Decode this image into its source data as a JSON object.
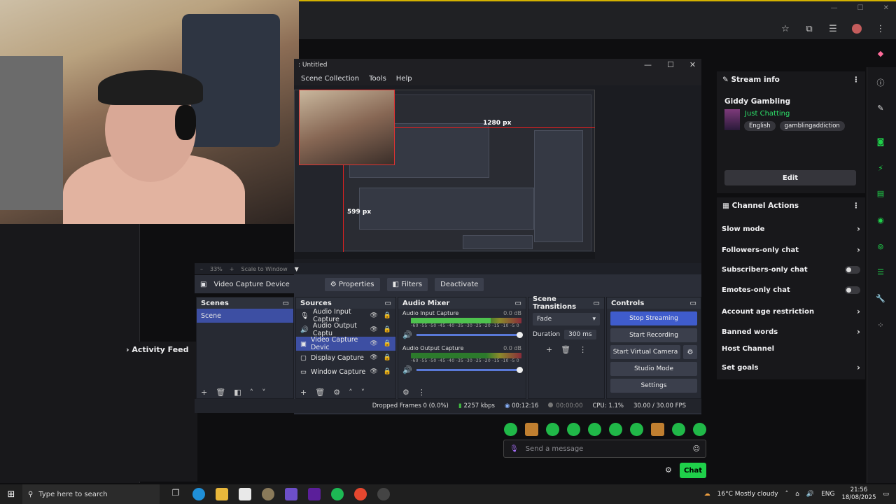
{
  "obs": {
    "title": ": Untitled",
    "menu": [
      "Scene Collection",
      "Tools",
      "Help"
    ],
    "preview_width_label": "1280 px",
    "preview_height_label": "599 px",
    "zoom": {
      "percent": "33%",
      "scale_label": "Scale to Window"
    },
    "source_toolbar": {
      "source_name": "Video Capture Device",
      "properties": "Properties",
      "filters": "Filters",
      "deactivate": "Deactivate"
    },
    "scenes": {
      "title": "Scenes",
      "items": [
        "Scene"
      ]
    },
    "sources": {
      "title": "Sources",
      "items": [
        "Audio Input Capture",
        "Audio Output Captu",
        "Video Capture Devic",
        "Display Capture",
        "Window Capture"
      ]
    },
    "audio_mixer": {
      "title": "Audio Mixer",
      "tracks": [
        {
          "name": "Audio Input Capture",
          "db": "0.0 dB",
          "level": 0.72,
          "volume": 1.0
        },
        {
          "name": "Audio Output Capture",
          "db": "0.0 dB",
          "level": 0.0,
          "volume": 1.0
        }
      ],
      "scale": "-60 -55 -50 -45 -40 -35 -30 -25 -20 -15 -10 -5 0"
    },
    "transitions": {
      "title": "Scene Transitions",
      "selected": "Fade",
      "duration_label": "Duration",
      "duration_value": "300 ms"
    },
    "controls": {
      "title": "Controls",
      "stop_streaming": "Stop Streaming",
      "start_recording": "Start Recording",
      "start_virtual_camera": "Start Virtual Camera",
      "studio_mode": "Studio Mode",
      "settings": "Settings"
    },
    "status": {
      "dropped_frames": "Dropped Frames 0 (0.0%)",
      "bitrate": "2257 kbps",
      "stream_time": "00:12:16",
      "record_time": "00:00:00",
      "cpu": "CPU: 1.1%",
      "fps": "30.00 / 30.00 FPS"
    }
  },
  "activity_feed": {
    "title": "Activity Feed"
  },
  "stream_info": {
    "title": "Stream info",
    "channel_name": "Giddy Gambling",
    "category": "Just Chatting",
    "tags": [
      "English",
      "gamblingaddiction"
    ],
    "edit_label": "Edit"
  },
  "channel_actions": {
    "title": "Channel Actions",
    "items": [
      {
        "label": "Slow mode",
        "control": "chevron"
      },
      {
        "label": "Followers-only chat",
        "control": "chevron"
      },
      {
        "label": "Subscribers-only chat",
        "control": "toggle"
      },
      {
        "label": "Emotes-only chat",
        "control": "toggle"
      },
      {
        "label": "Account age restriction",
        "control": "chevron"
      },
      {
        "label": "Banned words",
        "control": "chevron"
      },
      {
        "label": "Host Channel",
        "control": "none"
      },
      {
        "label": "Set goals",
        "control": "chevron"
      }
    ]
  },
  "chat": {
    "placeholder": "Send a message",
    "send_label": "Chat"
  },
  "taskbar": {
    "search_placeholder": "Type here to search",
    "weather": "16°C  Mostly cloudy",
    "language": "ENG",
    "time": "21:56",
    "date": "18/08/2025"
  },
  "colors": {
    "twitch_green": "#1fd04a",
    "obs_accent": "#3f5ccc",
    "category_green": "#2de26a"
  }
}
